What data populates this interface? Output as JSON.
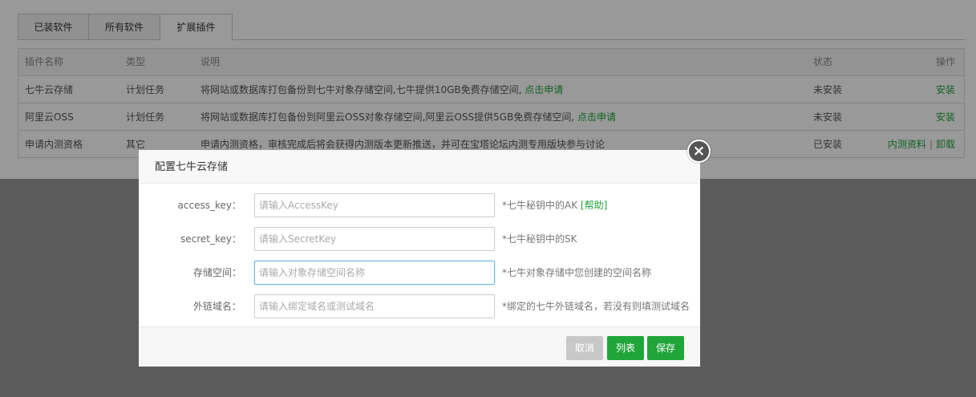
{
  "tabs": [
    {
      "label": "已装软件"
    },
    {
      "label": "所有软件"
    },
    {
      "label": "扩展插件"
    }
  ],
  "table": {
    "headers": {
      "name": "插件名称",
      "type": "类型",
      "desc": "说明",
      "status": "状态",
      "op": "操作"
    },
    "rows": [
      {
        "name": "七牛云存储",
        "type": "计划任务",
        "desc": "将网站或数据库打包备份到七牛对象存储空间,七牛提供10GB免费存储空间,",
        "link": "点击申请",
        "status": "未安装",
        "action": "安装"
      },
      {
        "name": "阿里云OSS",
        "type": "计划任务",
        "desc": "将网站或数据库打包备份到阿里云OSS对象存储空间,阿里云OSS提供5GB免费存储空间,",
        "link": "点击申请",
        "status": "未安装",
        "action": "安装"
      },
      {
        "name": "申请内测资格",
        "type": "其它",
        "desc": "申请内测资格，审核完成后将会获得内测版本更新推送，并可在宝塔论坛内测专用版块参与讨论",
        "status": "已安装",
        "action1": "内测资料",
        "separator": "|",
        "action2": "卸载"
      }
    ]
  },
  "modal": {
    "title": "配置七牛云存储",
    "close_symbol": "×",
    "fields": [
      {
        "label": "access_key：",
        "placeholder": "请输入AccessKey",
        "value": "",
        "tip": "*七牛秘钥中的AK",
        "help": "[帮助]"
      },
      {
        "label": "secret_key：",
        "placeholder": "请输入SecretKey",
        "value": "",
        "tip": "*七牛秘钥中的SK"
      },
      {
        "label": "存储空间：",
        "placeholder": "请输入对象存储空间名称",
        "value": "",
        "tip": "*七牛对象存储中您创建的空间名称"
      },
      {
        "label": "外链域名：",
        "placeholder": "请输入绑定域名或测试域名",
        "value": "",
        "tip": "*绑定的七牛外链域名，若没有则填测试域名"
      }
    ],
    "buttons": {
      "cancel": "取消",
      "list": "列表",
      "save": "保存"
    }
  },
  "colors": {
    "accent": "#20a53a",
    "overlay": "#9a9a9a",
    "cancel": "#c8c8c8"
  }
}
